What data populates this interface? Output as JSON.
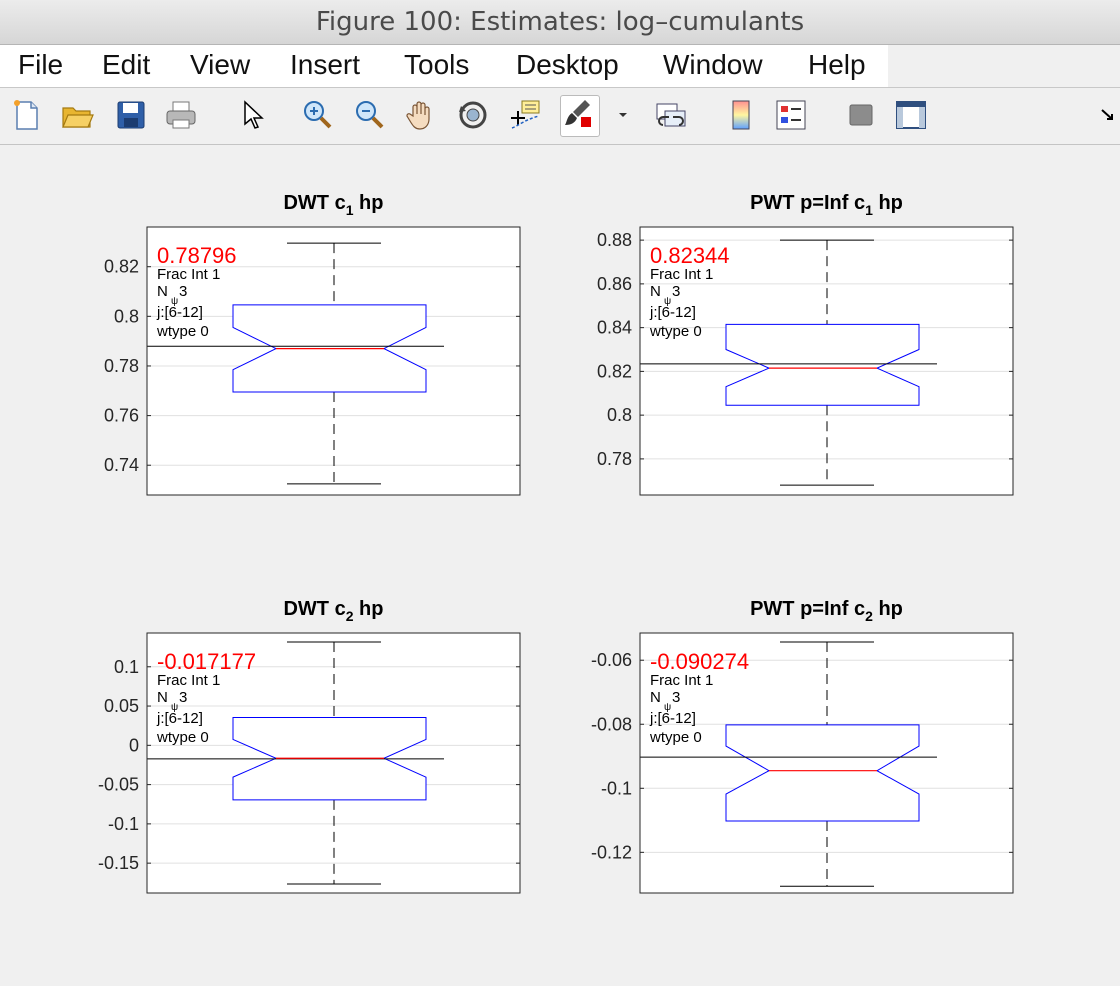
{
  "window": {
    "title": "Figure 100: Estimates: log–cumulants"
  },
  "menu": [
    "File",
    "Edit",
    "View",
    "Insert",
    "Tools",
    "Desktop",
    "Window",
    "Help"
  ],
  "toolbar": {
    "icons": [
      "new-figure-icon",
      "open-file-icon",
      "save-icon",
      "print-icon",
      "pointer-icon",
      "zoom-in-icon",
      "zoom-out-icon",
      "pan-hand-icon",
      "rotate-3d-icon",
      "data-cursor-icon",
      "brush-icon",
      "brush-dropdown-icon",
      "link-plot-icon",
      "colorbar-icon",
      "legend-icon",
      "hide-plot-tools-icon",
      "show-plot-tools-icon",
      "dock-arrow-icon"
    ]
  },
  "colors": {
    "box": "#0000ff",
    "median": "#ff0000",
    "estimate_text": "#ff0000",
    "grid": "#e0e0e0"
  },
  "chart_data": [
    {
      "type": "box",
      "title": "DWT c_1 hp",
      "title_main": "DWT c",
      "title_sub": "1",
      "title_tail": " hp",
      "ylim": [
        0.728,
        0.836
      ],
      "yticks": [
        0.74,
        0.76,
        0.78,
        0.8,
        0.82
      ],
      "ytick_labels": [
        "0.74",
        "0.76",
        "0.78",
        "0.8",
        "0.82"
      ],
      "box": {
        "q1": 0.7695,
        "median": 0.787,
        "q3": 0.8046,
        "notch_low": 0.7785,
        "notch_high": 0.7955,
        "whisker_low": 0.7325,
        "whisker_high": 0.8295
      },
      "estimate_line": 0.78796,
      "estimate_label": "0.78796",
      "info": [
        "Frac Int 1",
        "N",
        "3",
        "j:[6-12]",
        "wtype 0"
      ],
      "info_sub": "ψ"
    },
    {
      "type": "box",
      "title": "PWT p=Inf c_1 hp",
      "title_main": "PWT p=Inf c",
      "title_sub": "1",
      "title_tail": " hp",
      "ylim": [
        0.7635,
        0.886
      ],
      "yticks": [
        0.78,
        0.8,
        0.82,
        0.84,
        0.86,
        0.88
      ],
      "ytick_labels": [
        "0.78",
        "0.8",
        "0.82",
        "0.84",
        "0.86",
        "0.88"
      ],
      "box": {
        "q1": 0.8045,
        "median": 0.8215,
        "q3": 0.8415,
        "notch_low": 0.813,
        "notch_high": 0.83,
        "whisker_low": 0.768,
        "whisker_high": 0.88
      },
      "estimate_line": 0.82344,
      "estimate_label": "0.82344",
      "info": [
        "Frac Int 1",
        "N",
        "3",
        "j:[6-12]",
        "wtype 0"
      ],
      "info_sub": "ψ"
    },
    {
      "type": "box",
      "title": "DWT c_2 hp",
      "title_main": "DWT c",
      "title_sub": "2",
      "title_tail": " hp",
      "ylim": [
        -0.188,
        0.143
      ],
      "yticks": [
        -0.15,
        -0.1,
        -0.05,
        0,
        0.05,
        0.1
      ],
      "ytick_labels": [
        "-0.15",
        "-0.1",
        "-0.05",
        "0",
        "0.05",
        "0.1"
      ],
      "box": {
        "q1": -0.0695,
        "median": -0.0165,
        "q3": 0.0355,
        "notch_low": -0.0405,
        "notch_high": 0.0075,
        "whisker_low": -0.1765,
        "whisker_high": 0.1315
      },
      "estimate_line": -0.017177,
      "estimate_label": "-0.017177",
      "info": [
        "Frac Int 1",
        "N",
        "3",
        "j:[6-12]",
        "wtype 0"
      ],
      "info_sub": "ψ"
    },
    {
      "type": "box",
      "title": "PWT p=Inf c_2 hp",
      "title_main": "PWT p=Inf c",
      "title_sub": "2",
      "title_tail": " hp",
      "ylim": [
        -0.1327,
        -0.0515
      ],
      "yticks": [
        -0.12,
        -0.1,
        -0.08,
        -0.06
      ],
      "ytick_labels": [
        "-0.12",
        "-0.1",
        "-0.08",
        "-0.06"
      ],
      "box": {
        "q1": -0.1102,
        "median": -0.0945,
        "q3": -0.0802,
        "notch_low": -0.1018,
        "notch_high": -0.0868,
        "whisker_low": -0.1306,
        "whisker_high": -0.0543
      },
      "estimate_line": -0.090274,
      "estimate_label": "-0.090274",
      "info": [
        "Frac Int 1",
        "N",
        "3",
        "j:[6-12]",
        "wtype 0"
      ],
      "info_sub": "ψ"
    }
  ]
}
